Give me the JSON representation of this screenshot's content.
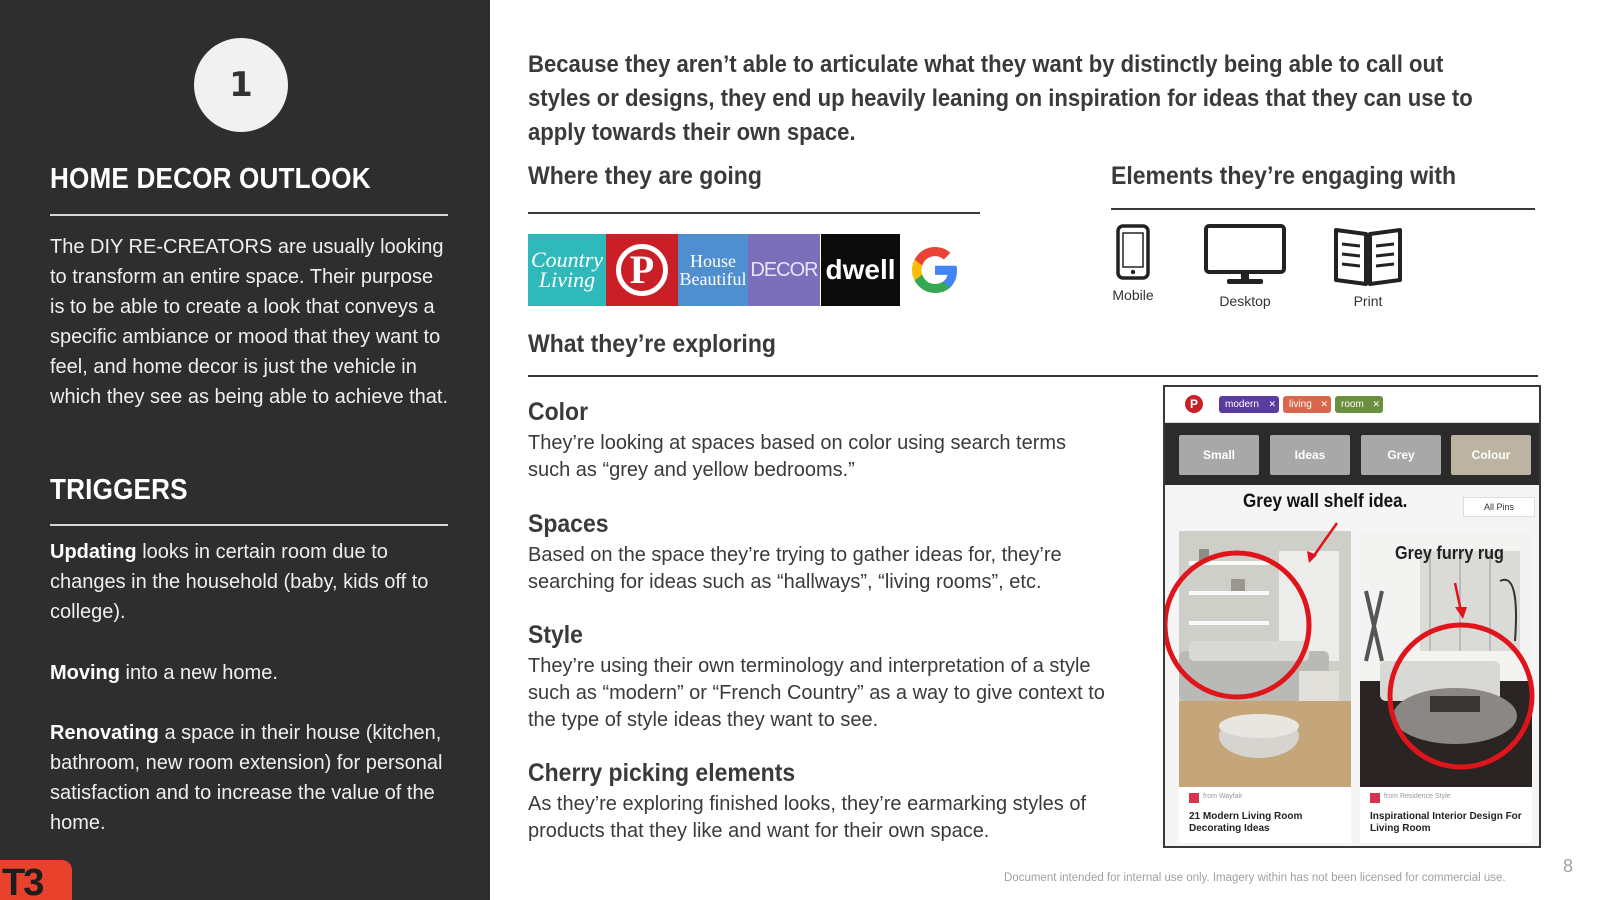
{
  "left": {
    "step_number": "1",
    "title": "HOME DECOR OUTLOOK",
    "intro": "The DIY RE-CREATORS are usually looking to transform an entire space. Their purpose is to be able to create a look that conveys a specific ambiance or mood that they want to feel, and home decor is just the vehicle in which they see as being able to achieve that.",
    "triggers_title": "TRIGGERS",
    "triggers": [
      {
        "bold": "Updating",
        "text": " looks in certain room due to changes in the household (baby, kids off to college)."
      },
      {
        "bold": "Moving",
        "text": " into a new home."
      },
      {
        "bold": "Renovating",
        "text": " a space in their house (kitchen, bathroom, new room extension) for personal satisfaction and to increase the value of the home."
      }
    ],
    "logo": "T3"
  },
  "headline": "Because they aren’t able to articulate what they want by distinctly being able to call out styles or designs, they end up heavily leaning on inspiration for ideas that they can use to apply towards their own space.",
  "going": {
    "title": "Where they are going",
    "sites": [
      {
        "name": "Country Living",
        "label": "Country Living",
        "color": "#2fb9bb"
      },
      {
        "name": "Pinterest",
        "label": "P",
        "color": "#cb1f27"
      },
      {
        "name": "House Beautiful",
        "label": "House Beautiful",
        "color": "#4f8fd0"
      },
      {
        "name": "Elle Decor",
        "label": "DECOR",
        "color": "#7a6fb8"
      },
      {
        "name": "dwell",
        "label": "dwell",
        "color": "#0b0b0b"
      },
      {
        "name": "Google",
        "label": "G",
        "color": "#4285f4"
      }
    ]
  },
  "elements": {
    "title": "Elements they’re engaging with",
    "items": [
      {
        "icon": "mobile-icon",
        "label": "Mobile"
      },
      {
        "icon": "desktop-icon",
        "label": "Desktop"
      },
      {
        "icon": "print-icon",
        "label": "Print"
      }
    ]
  },
  "exploring": {
    "title": "What they’re exploring",
    "items": [
      {
        "head": "Color",
        "body": "They’re looking at spaces based on color using search terms such as “grey and yellow bedrooms.”"
      },
      {
        "head": "Spaces",
        "body": "Based on the space they’re trying to gather ideas for, they’re searching for ideas such as “hallways”, “living rooms”, etc."
      },
      {
        "head": "Style",
        "body": "They’re using their own terminology and interpretation of a style such as “modern” or “French Country” as a way to give context to the type of style ideas they want to see."
      },
      {
        "head": "Cherry picking elements",
        "body": "As they’re exploring finished looks, they’re earmarking styles of products that they like and want for their own space."
      }
    ]
  },
  "pinterest_shot": {
    "tags": [
      {
        "label": "modern",
        "color": "#5a3b9e"
      },
      {
        "label": "living",
        "color": "#d9674d"
      },
      {
        "label": "room",
        "color": "#6a8f3e"
      }
    ],
    "filters": [
      "Small",
      "Ideas",
      "Grey",
      "Colour"
    ],
    "caption_1": "Grey wall shelf idea.",
    "all_pins": "All Pins",
    "caption_2": "Grey furry rug",
    "cards": [
      {
        "source": "from Wayfair",
        "title": "21 Modern Living Room Decorating Ideas"
      },
      {
        "source": "from Residence Style",
        "title": "Inspirational Interior Design For Living Room"
      }
    ],
    "annotation_color": "#e0141b"
  },
  "footer": {
    "disclaimer": "Document intended for internal use only. Imagery within has not been licensed for commercial use.",
    "page_number": "8"
  }
}
